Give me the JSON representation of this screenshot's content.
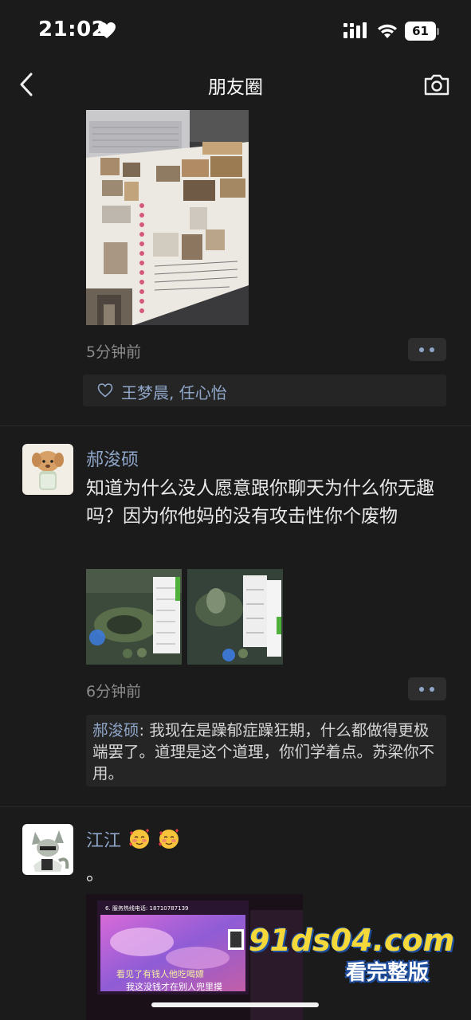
{
  "status_bar": {
    "time": "21:02",
    "battery": "61"
  },
  "nav": {
    "title": "朋友圈"
  },
  "posts": [
    {
      "time": "5分钟前",
      "likes": "王梦晨, 任心怡"
    },
    {
      "username": "郝浚硕",
      "text": "知道为什么没人愿意跟你聊天为什么你无趣吗？因为你他妈的没有攻击性你个废物",
      "time": "6分钟前",
      "comment": {
        "author": "郝浚硕",
        "text": ": 我现在是躁郁症躁狂期，什么都做得更极端罢了。道理是这个道理，你们学着点。苏梁你不用。"
      }
    },
    {
      "username": "江江",
      "text": "。",
      "video_text": {
        "line1": "看见了有钱人他吃喝嫖",
        "line2": "我这没钱才在别人兜里摸",
        "top": "6. 服务热线电话: 18710787139"
      }
    }
  ],
  "watermark": {
    "line1": "91ds04.com",
    "line2": "看完整版"
  },
  "colors": {
    "background": "#1b1b1b",
    "link": "#8fa6c8",
    "secondary_text": "#8a8a8a"
  }
}
